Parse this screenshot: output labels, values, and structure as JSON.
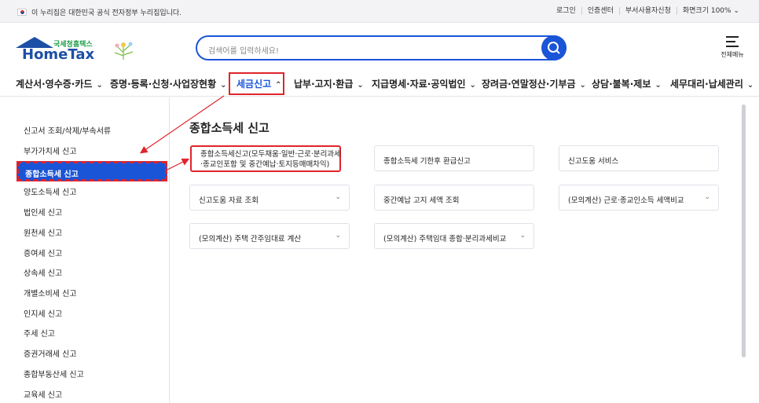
{
  "topbar": {
    "gov_notice": "이 누리집은 대한민국 공식 전자정부 누리집입니다.",
    "links": [
      "로그인",
      "인증센터",
      "부서사용자신청",
      "화면크기 100% ⌄"
    ]
  },
  "logo": {
    "small": "국세청홈택스",
    "big": "HomeTax"
  },
  "search": {
    "placeholder": "검색어를 입력하세요!"
  },
  "menu_button": "전체메뉴",
  "gnb": [
    "계산서·영수증·카드",
    "증명·등록·신청·사업장현황",
    "세금신고",
    "납부·고지·환급",
    "지급명세·자료·공익법인",
    "장려금·연말정산·기부금",
    "상담·불복·제보",
    "세무대리·납세관리"
  ],
  "sidebar": [
    "신고서 조회/삭제/부속서류",
    "부가가치세 신고",
    "종합소득세 신고",
    "양도소득세 신고",
    "법인세 신고",
    "원천세 신고",
    "증여세 신고",
    "상속세 신고",
    "개별소비세 신고",
    "인지세 신고",
    "주세 신고",
    "증권거래세 신고",
    "종합부동산세 신고",
    "교육세 신고"
  ],
  "content": {
    "title": "종합소득세 신고",
    "cards": [
      "종합소득세신고(모두채움·일반·근로·분리과세·종교인포함 및 중간예납·토지등매매차익)",
      "종합소득세 기한후 환급신고",
      "신고도움 서비스",
      "신고도움 자료 조회",
      "중간예납 고지 세액 조회",
      "(모의계산) 근로·종교인소득 세액비교",
      "(모의계산) 주택 간주임대료 계산",
      "(모의계산) 주택임대 종합·분리과세비교"
    ]
  },
  "colors": {
    "accent": "#1a55d8",
    "highlight": "#e0242b",
    "logo_green": "#1e9e4a"
  }
}
